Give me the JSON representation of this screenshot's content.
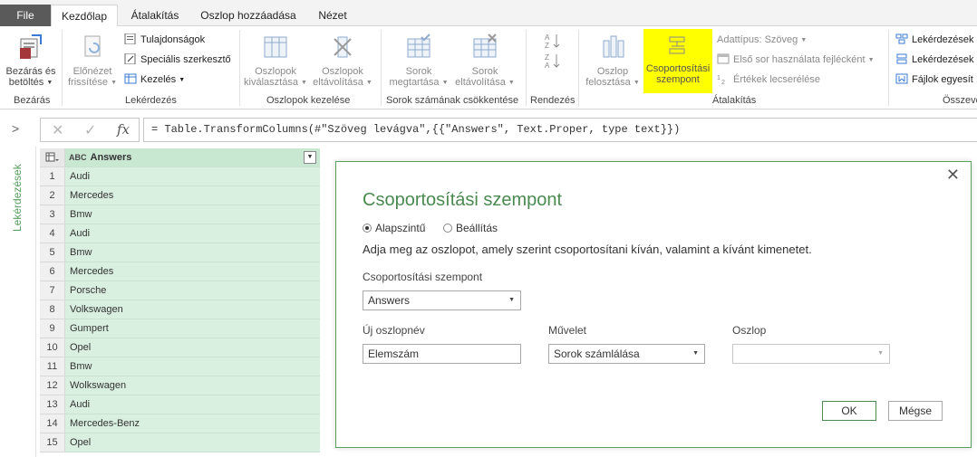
{
  "tabs": {
    "file": "File",
    "home": "Kezdőlap",
    "transform": "Átalakítás",
    "add_column": "Oszlop hozzáadása",
    "view": "Nézet"
  },
  "ribbon": {
    "close_load": [
      "Bezárás és",
      "betöltés"
    ],
    "close_group": "Bezárás",
    "preview_refresh": [
      "Előnézet",
      "frissítése"
    ],
    "properties": "Tulajdonságok",
    "advanced_editor": "Speciális szerkesztő",
    "manage": "Kezelés",
    "query_group": "Lekérdezés",
    "choose_columns": [
      "Oszlopok",
      "kiválasztása"
    ],
    "remove_columns": [
      "Oszlopok",
      "eltávolítása"
    ],
    "manage_columns_group": "Oszlopok kezelése",
    "keep_rows": [
      "Sorok",
      "megtartása"
    ],
    "remove_rows": [
      "Sorok",
      "eltávolítása"
    ],
    "reduce_rows_group": "Sorok számának csökkentése",
    "sort_group": "Rendezés",
    "split_column": [
      "Oszlop",
      "felosztása"
    ],
    "group_by": [
      "Csoportosítási",
      "szempont"
    ],
    "data_type": "Adattípus: Szöveg",
    "use_first_row": "Első sor használata fejlécként",
    "replace_values": "Értékek lecserélése",
    "transform_group": "Átalakítás",
    "merge_queries": "Lekérdezések",
    "append_queries": "Lekérdezések",
    "combine_files": "Fájlok egyesít",
    "combine_group": "Összevo",
    "highlight_color": "#ffff00"
  },
  "formula_bar": {
    "formula": "= Table.TransformColumns(#\"Szöveg levágva\",{{\"Answers\", Text.Proper, type text}})",
    "fx": "fx"
  },
  "side_panel": {
    "label": "Lekérdezések"
  },
  "table": {
    "type_label": "ABC",
    "column_header": "Answers",
    "row_numbers": [
      "1",
      "2",
      "3",
      "4",
      "5",
      "6",
      "7",
      "8",
      "9",
      "10",
      "11",
      "12",
      "13",
      "14",
      "15"
    ],
    "rows": [
      "Audi",
      "Mercedes",
      "Bmw",
      "Audi",
      "Bmw",
      "Mercedes",
      "Porsche",
      "Volkswagen",
      "Gumpert",
      "Opel",
      "Bmw",
      "Wolkswagen",
      "Audi",
      "Mercedes-Benz",
      "Opel"
    ],
    "fill_color": "#d9efdf"
  },
  "dialog": {
    "title": "Csoportosítási szempont",
    "radio_basic": "Alapszintű",
    "radio_advanced": "Beállítás",
    "description": "Adja meg az oszlopot, amely szerint csoportosítani kíván, valamint a kívánt kimenetet.",
    "group_by_label": "Csoportosítási szempont",
    "group_by_value": "Answers",
    "new_column_label": "Új oszlopnév",
    "new_column_value": "Elemszám",
    "operation_label": "Művelet",
    "operation_value": "Sorok számlálása",
    "column_label": "Oszlop",
    "column_value": "",
    "ok": "OK",
    "cancel": "Mégse",
    "accent_color": "#58a05e"
  }
}
